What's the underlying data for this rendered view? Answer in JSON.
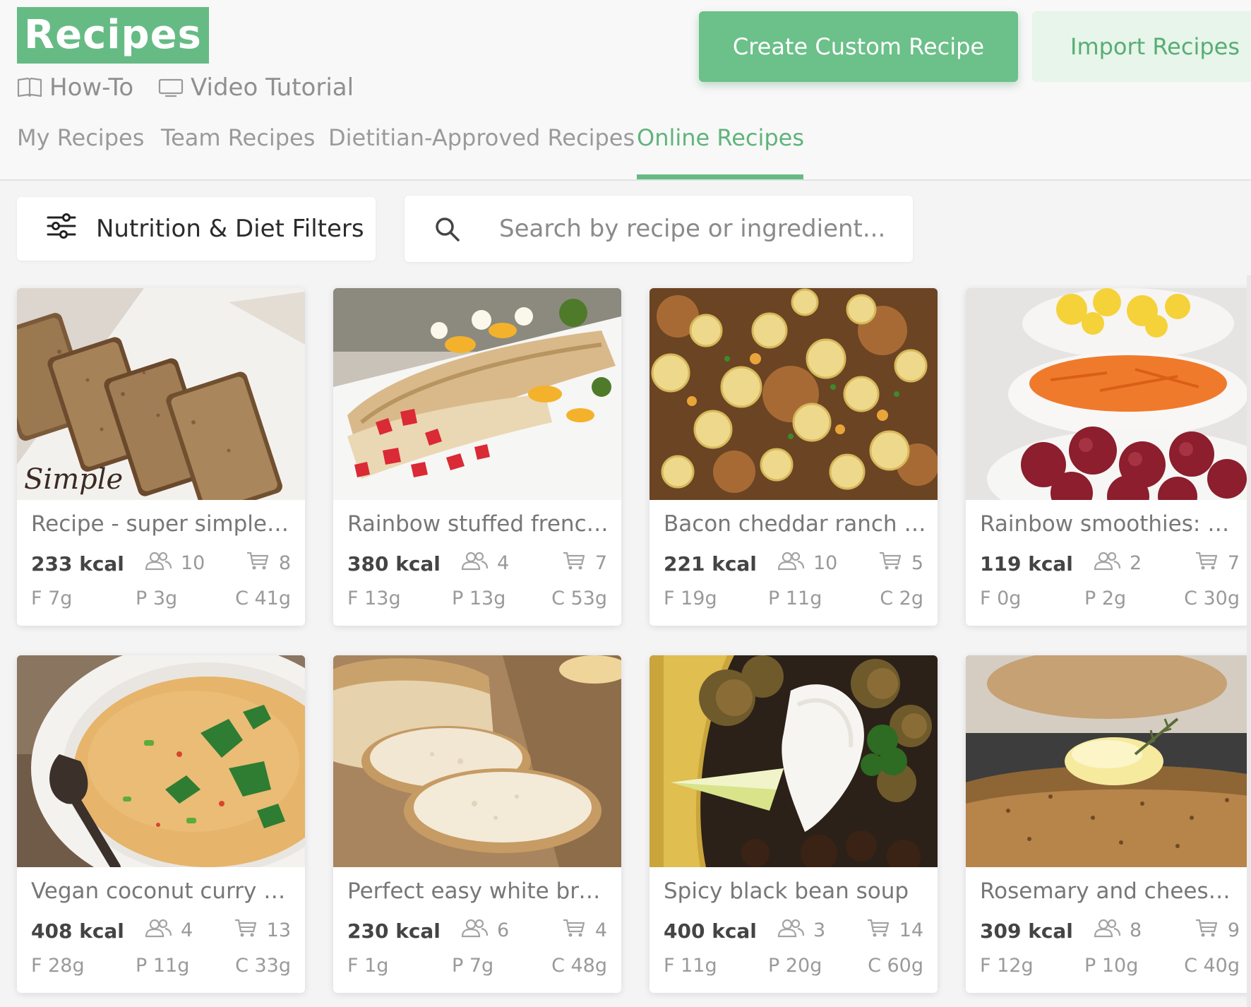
{
  "header": {
    "brand": "Recipes",
    "links": [
      {
        "label": "How-To",
        "icon": "book-icon"
      },
      {
        "label": "Video Tutorial",
        "icon": "monitor-icon"
      }
    ],
    "create_button": "Create Custom Recipe",
    "import_button": "Import Recipes"
  },
  "tabs": [
    {
      "label": "My Recipes",
      "active": false
    },
    {
      "label": "Team Recipes",
      "active": false
    },
    {
      "label": "Dietitian-Approved Recipes",
      "active": false
    },
    {
      "label": "Online Recipes",
      "active": true
    }
  ],
  "filters": {
    "button_label": "Nutrition & Diet Filters",
    "search_placeholder": "Search by recipe or ingredient..."
  },
  "colors": {
    "accent": "#66bb85",
    "accent_light": "#e7f5ea",
    "text_muted": "#9a9a9a"
  },
  "recipes": [
    {
      "title": "Recipe - super simple ...",
      "kcal": "233 kcal",
      "servings": "10",
      "ingredients": "8",
      "fat": "F 7g",
      "protein": "P 3g",
      "carbs": "C 41g",
      "photo": "banana-bread-slices",
      "photo_caption": "Simple"
    },
    {
      "title": "Rainbow stuffed french...",
      "kcal": "380 kcal",
      "servings": "4",
      "ingredients": "7",
      "fat": "F 13g",
      "protein": "P 13g",
      "carbs": "C 53g",
      "photo": "stuffed-french-toast-with-fruit"
    },
    {
      "title": "Bacon cheddar ranch s...",
      "kcal": "221 kcal",
      "servings": "10",
      "ingredients": "5",
      "fat": "F 19g",
      "protein": "P 11g",
      "carbs": "C 2g",
      "photo": "cheese-puffs-with-bacon"
    },
    {
      "title": "Rainbow smoothies: a f...",
      "kcal": "119 kcal",
      "servings": "2",
      "ingredients": "7",
      "fat": "F 0g",
      "protein": "P 2g",
      "carbs": "C 30g",
      "photo": "bowls-of-fruit-and-carrots"
    },
    {
      "title": "Vegan coconut curry so...",
      "kcal": "408 kcal",
      "servings": "4",
      "ingredients": "13",
      "fat": "F 28g",
      "protein": "P 11g",
      "carbs": "C 33g",
      "photo": "curry-soup-bowl"
    },
    {
      "title": "Perfect easy white bread",
      "kcal": "230 kcal",
      "servings": "6",
      "ingredients": "4",
      "fat": "F 1g",
      "protein": "P 7g",
      "carbs": "C 48g",
      "photo": "sliced-white-bread"
    },
    {
      "title": "Spicy black bean soup",
      "kcal": "400 kcal",
      "servings": "3",
      "ingredients": "14",
      "fat": "F 11g",
      "protein": "P 20g",
      "carbs": "C 60g",
      "photo": "black-bean-soup-with-sour-cream"
    },
    {
      "title": "Rosemary and cheese s...",
      "kcal": "309 kcal",
      "servings": "8",
      "ingredients": "9",
      "fat": "F 12g",
      "protein": "P 10g",
      "carbs": "C 40g",
      "photo": "rosemary-cheese-bake"
    }
  ]
}
